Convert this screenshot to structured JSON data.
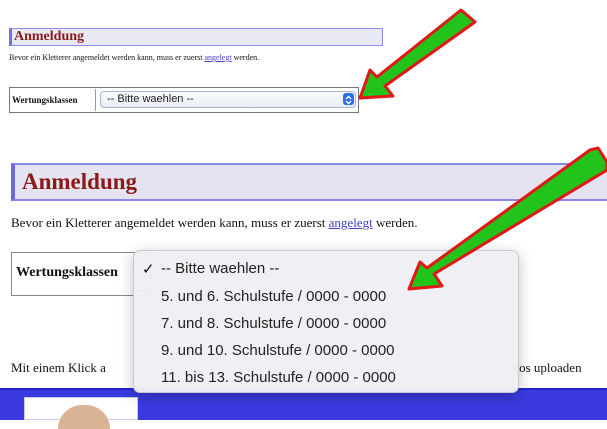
{
  "top_panel": {
    "title": "Anmeldung",
    "description_before": "Bevor ein Kletterer angemeldet werden kann, muss er zuerst ",
    "description_link": "angelegt",
    "description_after": " werden.",
    "field_label": "Wertungsklassen",
    "select_value": "-- Bitte waehlen --"
  },
  "bottom_panel": {
    "title": "Anmeldung",
    "description_before": "Bevor ein Kletterer angemeldet werden kann, muss er zuerst ",
    "description_link": "angelegt",
    "description_after": " werden.",
    "field_label": "Wertungsklassen",
    "click_text": "Mit einem Klick a",
    "uploads_text": "otos uploaden"
  },
  "dropdown": {
    "check_mark": "✓",
    "options": [
      "-- Bitte waehlen --",
      "5. und 6. Schulstufe / 0000 - 0000",
      "7. und 8. Schulstufe / 0000 - 0000",
      "9. und 10. Schulstufe / 0000 - 0000",
      "11. bis 13. Schulstufe / 0000 - 0000"
    ],
    "selected_index": 0
  },
  "colors": {
    "title": "#8b1a1a",
    "link": "#4040c0",
    "arrow_fill": "#22c41c",
    "arrow_outline": "#e01818",
    "bar": "#3a3ae0"
  }
}
